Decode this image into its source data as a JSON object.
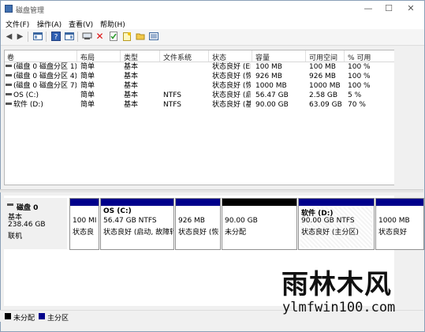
{
  "window": {
    "title": "磁盘管理"
  },
  "menu": [
    "文件(F)",
    "操作(A)",
    "查看(V)",
    "帮助(H)"
  ],
  "toolbar_icons": [
    "back-icon",
    "forward-icon",
    "console-tree-icon",
    "help-icon",
    "properties-icon",
    "connect-icon",
    "delete-icon",
    "check-icon",
    "new-icon",
    "open-icon",
    "list-icon"
  ],
  "columns": [
    "卷",
    "布局",
    "类型",
    "文件系统",
    "状态",
    "容量",
    "可用空间",
    "% 可用"
  ],
  "volumes": [
    [
      "(磁盘 0 磁盘分区 1)",
      "简单",
      "基本",
      "",
      "状态良好 (EFI 系统分区)",
      "100 MB",
      "100 MB",
      "100 %"
    ],
    [
      "(磁盘 0 磁盘分区 4)",
      "简单",
      "基本",
      "",
      "状态良好 (恢复分区)",
      "926 MB",
      "926 MB",
      "100 %"
    ],
    [
      "(磁盘 0 磁盘分区 7)",
      "简单",
      "基本",
      "",
      "状态良好 (恢复分区)",
      "1000 MB",
      "1000 MB",
      "100 %"
    ],
    [
      "OS (C:)",
      "简单",
      "基本",
      "NTFS",
      "状态良好 (启动, 故障转储, 基本数据分区)",
      "56.47 GB",
      "2.58 GB",
      "5 %"
    ],
    [
      "软件 (D:)",
      "简单",
      "基本",
      "NTFS",
      "状态良好 (基本数据分区)",
      "90.00 GB",
      "63.09 GB",
      "70 %"
    ]
  ],
  "disk": {
    "name": "磁盘 0",
    "type": "基本",
    "size": "238.46 GB",
    "status": "联机"
  },
  "partitions": [
    {
      "title": "",
      "line1": "100 MI",
      "line2": "状态良",
      "bar": "#00008b"
    },
    {
      "title": "OS  (C:)",
      "line1": "56.47 GB NTFS",
      "line2": "状态良好 (启动, 故障转",
      "bar": "#00008b"
    },
    {
      "title": "",
      "line1": "926 MB",
      "line2": "状态良好 (恢",
      "bar": "#00008b"
    },
    {
      "title": "",
      "line1": "90.00 GB",
      "line2": "未分配",
      "bar": "#000000"
    },
    {
      "title": "软件  (D:)",
      "line1": "90.00 GB NTFS",
      "line2": "状态良好 (主分区)",
      "bar": "#00008b"
    },
    {
      "title": "",
      "line1": "1000 MB",
      "line2": "状态良好",
      "bar": "#00008b"
    }
  ],
  "legend": [
    {
      "label": "未分配",
      "color": "#000000"
    },
    {
      "label": "主分区",
      "color": "#00008b"
    }
  ],
  "watermark": {
    "text": "雨林木风",
    "url": "ylmfwin100.com"
  }
}
